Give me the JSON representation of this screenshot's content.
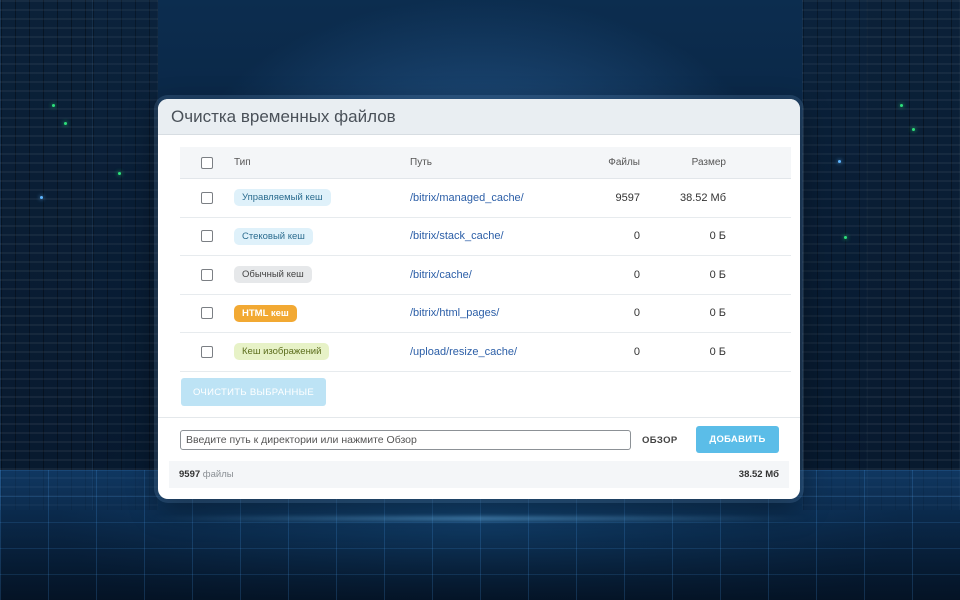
{
  "window": {
    "title": "Очистка временных файлов"
  },
  "table": {
    "headers": {
      "type": "Тип",
      "path": "Путь",
      "files": "Файлы",
      "size": "Размер"
    },
    "rows": [
      {
        "type": "Управляемый кеш",
        "badge": "managed",
        "path": "/bitrix/managed_cache/",
        "files": "9597",
        "size": "38.52 Мб"
      },
      {
        "type": "Стековый кеш",
        "badge": "stack",
        "path": "/bitrix/stack_cache/",
        "files": "0",
        "size": "0 Б"
      },
      {
        "type": "Обычный кеш",
        "badge": "regular",
        "path": "/bitrix/cache/",
        "files": "0",
        "size": "0 Б"
      },
      {
        "type": "HTML кеш",
        "badge": "html",
        "path": "/bitrix/html_pages/",
        "files": "0",
        "size": "0 Б"
      },
      {
        "type": "Кеш изображений",
        "badge": "images",
        "path": "/upload/resize_cache/",
        "files": "0",
        "size": "0 Б"
      }
    ]
  },
  "actions": {
    "clear_selected": "Очистить выбранные",
    "path_placeholder": "Введите путь к директории или нажмите Обзор",
    "browse": "Обзор",
    "add": "Добавить"
  },
  "footer": {
    "files_count": "9597",
    "files_label": "файлы",
    "total_size": "38.52 Мб"
  },
  "colors": {
    "accent": "#5bbde8",
    "accent_disabled": "#bde3f5",
    "link": "#2b5ea7",
    "html_badge": "#f2a933"
  }
}
